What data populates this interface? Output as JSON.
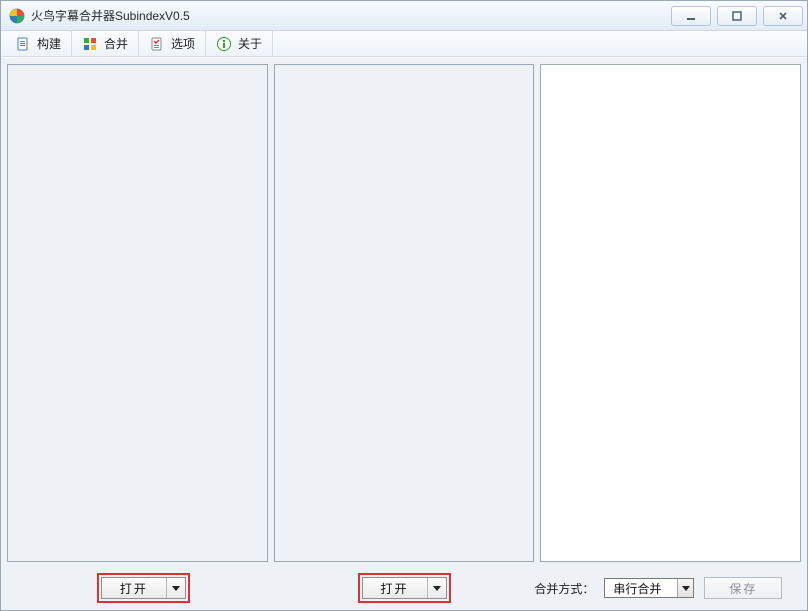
{
  "window": {
    "title": "火鸟字幕合并器SubindexV0.5"
  },
  "toolbar": {
    "items": [
      {
        "label": "构建",
        "icon": "document-icon"
      },
      {
        "label": "合并",
        "icon": "merge-icon"
      },
      {
        "label": "选项",
        "icon": "options-icon"
      },
      {
        "label": "关于",
        "icon": "about-icon"
      }
    ]
  },
  "buttons": {
    "open1": "打开",
    "open2": "打开",
    "merge_mode_label": "合并方式：",
    "save": "保存"
  },
  "combo": {
    "merge_mode_selected": "串行合并"
  }
}
